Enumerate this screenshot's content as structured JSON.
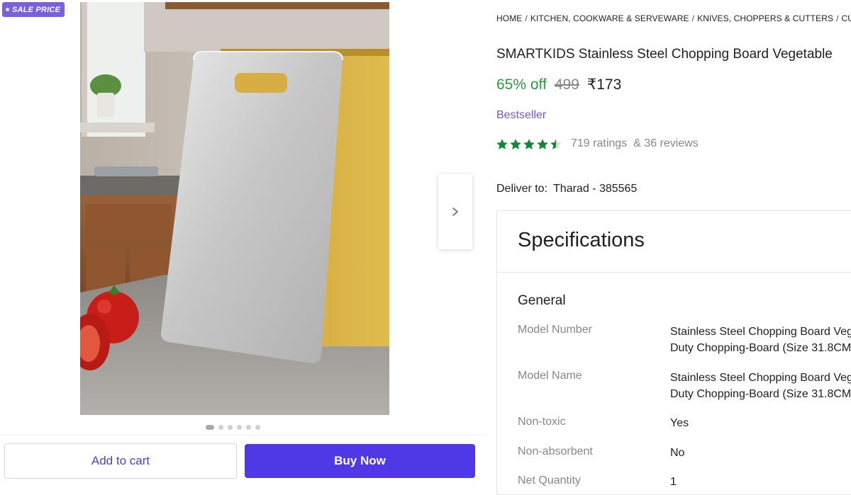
{
  "badge": {
    "label": "SALE PRICE"
  },
  "gallery": {
    "next_icon": "chevron-right-icon",
    "dot_count": 6,
    "active_dot": 0
  },
  "actions": {
    "add_to_cart": "Add to cart",
    "buy_now": "Buy Now"
  },
  "breadcrumb": [
    "HOME",
    "KITCHEN, COOKWARE & SERVEWARE",
    "KNIVES, CHOPPERS & CUTTERS",
    "CUTT"
  ],
  "product": {
    "title": "SMARTKIDS Stainless Steel Chopping Board Vegetable",
    "discount": "65% off",
    "mrp": "499",
    "price": "₹173",
    "tag": "Bestseller",
    "rating_value": 4.5,
    "ratings": "719 ratings",
    "reviews": "& 36 reviews"
  },
  "delivery": {
    "label": "Deliver to:",
    "location": "Tharad - 385565"
  },
  "specifications": {
    "title": "Specifications",
    "section": "General",
    "rows": [
      {
        "key": "Model Number",
        "value": [
          "Stainless Steel Chopping Board Veg",
          "Duty Chopping-Board (Size 31.8CM"
        ]
      },
      {
        "key": "Model Name",
        "value": [
          "Stainless Steel Chopping Board Veg",
          "Duty Chopping-Board (Size 31.8CM"
        ]
      },
      {
        "key": "Non-toxic",
        "value": [
          "Yes"
        ]
      },
      {
        "key": "Non-absorbent",
        "value": [
          "No"
        ]
      },
      {
        "key": "Net Quantity",
        "value": [
          "1"
        ]
      }
    ]
  },
  "colors": {
    "accent": "#4f38e6",
    "discount": "#2a9a3f",
    "bestseller": "#7b54d6",
    "stars": "#108934",
    "badge": "#7b5fe0"
  }
}
